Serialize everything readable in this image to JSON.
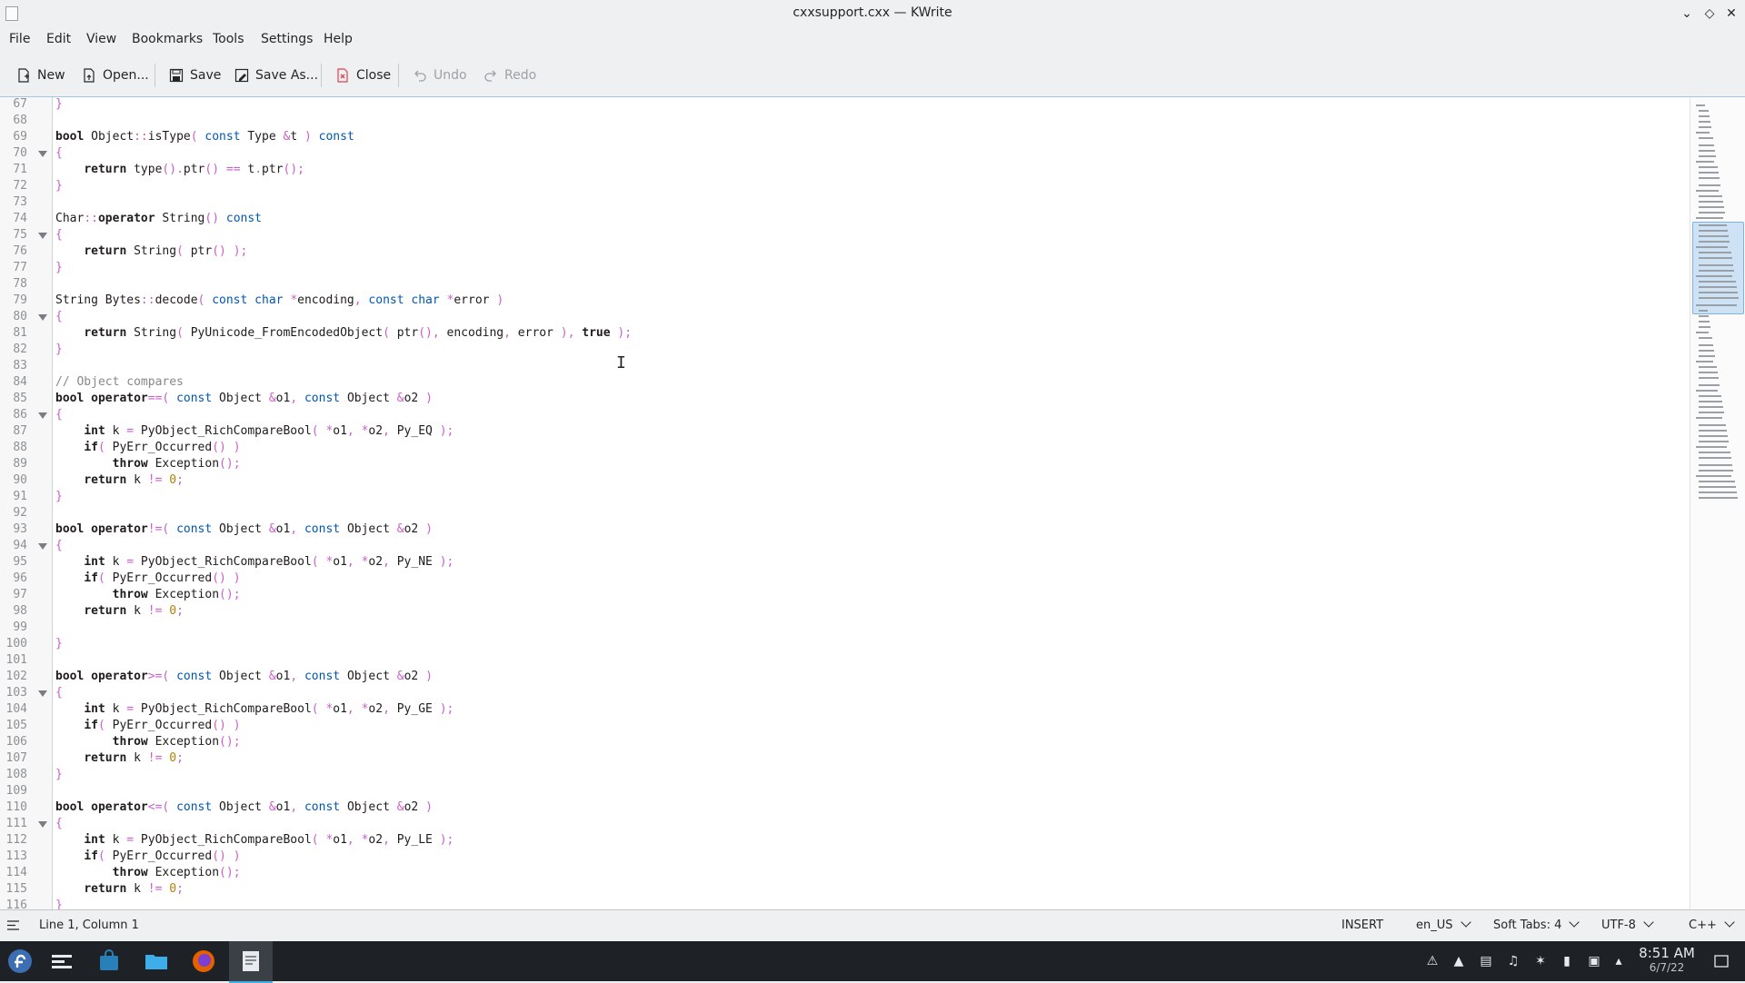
{
  "window": {
    "title": "cxxsupport.cxx — KWrite"
  },
  "menu": [
    "File",
    "Edit",
    "View",
    "Bookmarks",
    "Tools",
    "Settings",
    "Help"
  ],
  "toolbar": {
    "new": "New",
    "open": "Open...",
    "save": "Save",
    "save_as": "Save As...",
    "close": "Close",
    "undo": "Undo",
    "redo": "Redo"
  },
  "editor": {
    "lines": [
      {
        "n": "67",
        "t": "}"
      },
      {
        "n": "68",
        "t": ""
      },
      {
        "n": "69",
        "t": "bool Object::isType( const Type &t ) const"
      },
      {
        "n": "70",
        "t": "{",
        "fold": true
      },
      {
        "n": "71",
        "t": "    return type().ptr() == t.ptr();"
      },
      {
        "n": "72",
        "t": "}"
      },
      {
        "n": "73",
        "t": ""
      },
      {
        "n": "74",
        "t": "Char::operator String() const"
      },
      {
        "n": "75",
        "t": "{",
        "fold": true
      },
      {
        "n": "76",
        "t": "    return String( ptr() );"
      },
      {
        "n": "77",
        "t": "}"
      },
      {
        "n": "78",
        "t": ""
      },
      {
        "n": "79",
        "t": "String Bytes::decode( const char *encoding, const char *error )"
      },
      {
        "n": "80",
        "t": "{",
        "fold": true
      },
      {
        "n": "81",
        "t": "    return String( PyUnicode_FromEncodedObject( ptr(), encoding, error ), true );"
      },
      {
        "n": "82",
        "t": "}"
      },
      {
        "n": "83",
        "t": ""
      },
      {
        "n": "84",
        "t": "// Object compares"
      },
      {
        "n": "85",
        "t": "bool operator==( const Object &o1, const Object &o2 )"
      },
      {
        "n": "86",
        "t": "{",
        "fold": true
      },
      {
        "n": "87",
        "t": "    int k = PyObject_RichCompareBool( *o1, *o2, Py_EQ );"
      },
      {
        "n": "88",
        "t": "    if( PyErr_Occurred() )"
      },
      {
        "n": "89",
        "t": "        throw Exception();"
      },
      {
        "n": "90",
        "t": "    return k != 0;"
      },
      {
        "n": "91",
        "t": "}"
      },
      {
        "n": "92",
        "t": ""
      },
      {
        "n": "93",
        "t": "bool operator!=( const Object &o1, const Object &o2 )"
      },
      {
        "n": "94",
        "t": "{",
        "fold": true
      },
      {
        "n": "95",
        "t": "    int k = PyObject_RichCompareBool( *o1, *o2, Py_NE );"
      },
      {
        "n": "96",
        "t": "    if( PyErr_Occurred() )"
      },
      {
        "n": "97",
        "t": "        throw Exception();"
      },
      {
        "n": "98",
        "t": "    return k != 0;"
      },
      {
        "n": "99",
        "t": ""
      },
      {
        "n": "100",
        "t": "}"
      },
      {
        "n": "101",
        "t": ""
      },
      {
        "n": "102",
        "t": "bool operator>=( const Object &o1, const Object &o2 )"
      },
      {
        "n": "103",
        "t": "{",
        "fold": true
      },
      {
        "n": "104",
        "t": "    int k = PyObject_RichCompareBool( *o1, *o2, Py_GE );"
      },
      {
        "n": "105",
        "t": "    if( PyErr_Occurred() )"
      },
      {
        "n": "106",
        "t": "        throw Exception();"
      },
      {
        "n": "107",
        "t": "    return k != 0;"
      },
      {
        "n": "108",
        "t": "}"
      },
      {
        "n": "109",
        "t": ""
      },
      {
        "n": "110",
        "t": "bool operator<=( const Object &o1, const Object &o2 )"
      },
      {
        "n": "111",
        "t": "{",
        "fold": true
      },
      {
        "n": "112",
        "t": "    int k = PyObject_RichCompareBool( *o1, *o2, Py_LE );"
      },
      {
        "n": "113",
        "t": "    if( PyErr_Occurred() )"
      },
      {
        "n": "114",
        "t": "        throw Exception();"
      },
      {
        "n": "115",
        "t": "    return k != 0;"
      },
      {
        "n": "116",
        "t": "}"
      }
    ]
  },
  "status": {
    "position": "Line 1, Column 1",
    "mode": "INSERT",
    "dictionary": "en_US",
    "indent": "Soft Tabs: 4",
    "encoding": "UTF-8",
    "syntax": "C++"
  },
  "taskbar": {
    "time": "8:51 AM",
    "date": "6/7/22"
  },
  "colors": {
    "keyword": "#1f1c1b",
    "type": "#0057ae",
    "operator": "#ca60ca",
    "number": "#b08000",
    "comment": "#898887"
  }
}
